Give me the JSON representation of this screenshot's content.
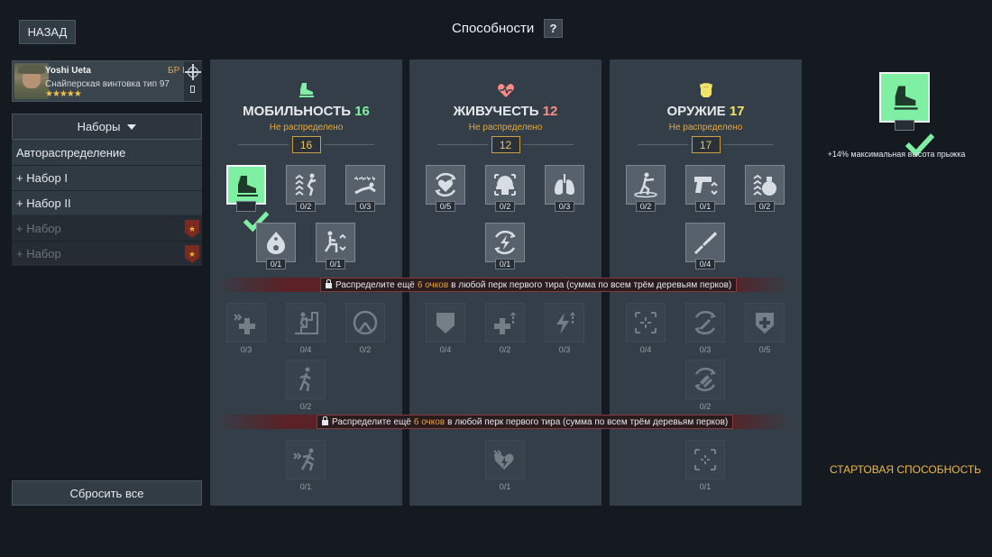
{
  "header": {
    "back_label": "НАЗАД",
    "title": "Способности",
    "help_label": "?"
  },
  "soldier": {
    "name": "Yoshi Ueta",
    "weapon": "Снайперская винтовка тип 97",
    "stars": "★★★★★",
    "rank": "БР I"
  },
  "sets": {
    "header": "Наборы",
    "items": [
      {
        "label": "Автораспределение"
      },
      {
        "label": "+ Набор I"
      },
      {
        "label": "+ Набор II"
      },
      {
        "label": "+ Набор"
      },
      {
        "label": "+ Набор"
      }
    ]
  },
  "reset_label": "Сбросить все",
  "colors": {
    "mobility": "#7ff0a3",
    "vitality": "#ff8a8a",
    "weapon": "#f2e46b",
    "points": "#e8a23a"
  },
  "panels": [
    {
      "title": "МОБИЛЬНОСТЬ",
      "points": "16",
      "status": "Не распределено",
      "box": "16",
      "icon": "boot-icon",
      "perks": [
        "0/2",
        "0/3",
        "0/1",
        "0/1",
        "0/3",
        "0/4",
        "0/2",
        "0/2",
        "0/1"
      ]
    },
    {
      "title": "ЖИВУЧЕСТЬ",
      "points": "12",
      "status": "Не распределено",
      "box": "12",
      "icon": "heart-icon",
      "perks": [
        "0/5",
        "0/2",
        "0/3",
        "0/1",
        "0/4",
        "0/2",
        "0/3",
        "0/1"
      ]
    },
    {
      "title": "ОРУЖИЕ",
      "points": "17",
      "status": "Не распределено",
      "box": "17",
      "icon": "fist-icon",
      "perks": [
        "0/2",
        "0/1",
        "0/2",
        "0/4",
        "0/4",
        "0/3",
        "0/5",
        "0/2",
        "0/1"
      ]
    }
  ],
  "lock_message": {
    "prefix": "Распределите ещё",
    "points": "6 очков",
    "suffix": "в любой перк первого тира (сумма по всем трём деревьям перков)"
  },
  "start_ability": {
    "description": "+14% максимальная высота прыжка",
    "label": "СТАРТОВАЯ СПОСОБНОСТЬ"
  }
}
